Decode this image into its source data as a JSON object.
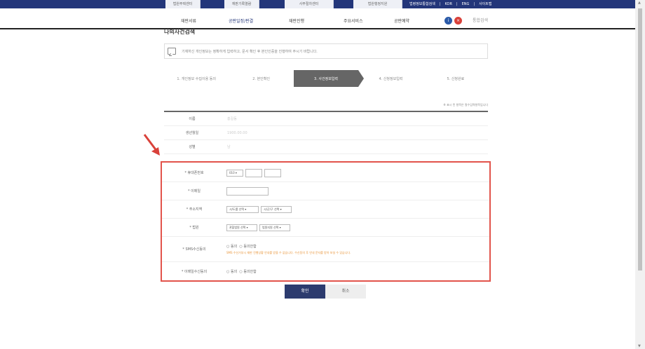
{
  "header": {
    "site_tabs": [
      "법원주택센터",
      "재판기록열람",
      "사무절차센터",
      "법원행정지원"
    ],
    "util_links": [
      "법령정보통합검색",
      "KOR",
      "ENG",
      "사이트맵"
    ],
    "nav": [
      "재판서류",
      "공판일정/판결",
      "재판진행",
      "주요서비스",
      "공판예약",
      "마이페이지"
    ],
    "icons": [
      "info",
      "close"
    ],
    "search": "통합검색"
  },
  "page": {
    "title": "나의사건검색"
  },
  "notice": "기재하신 개인정보는 정확하게 입력하고, 문서 확인 후 본인인증을 진행하여 주시기 바랍니다.",
  "steps": [
    "1. 개인정보 수집이용 동의",
    "2. 본인확인",
    "3. 사건정보입력",
    "4. 신청정보입력",
    "5. 신청완료"
  ],
  "active_step": 2,
  "required_note": "※ 표시 된 항목은 필수입력항목입니다",
  "info_rows": [
    {
      "label": "이름",
      "value": "홍길동"
    },
    {
      "label": "생년월일",
      "value": "1900.00.00"
    },
    {
      "label": "성별",
      "value": "남"
    }
  ],
  "form": {
    "phone_label": "* 휴대폰번호",
    "phone_prefix": "010",
    "email_label": "* 이메일",
    "address_label": "* 주소지역",
    "address_sel1": "시/도를 선택",
    "address_sel2": "시/군/구 선택",
    "court_label": "* 법원",
    "court_sel1": "관할법원 선택",
    "court_sel2": "법원지원 선택",
    "sms_label": "* SMS수신동의",
    "sms_options": [
      "동의",
      "동의안함"
    ],
    "sms_warning": "SMS 수신거부시 재판 진행상황 안내를 받을 수 없습니다. 수신동의 후 안내 문자를 받아 보실 수 있습니다.",
    "email_consent_label": "* 이메일수신동의",
    "email_consent_options": [
      "동의",
      "동의안함"
    ]
  },
  "buttons": {
    "confirm": "확인",
    "cancel": "취소"
  },
  "colors": {
    "navy": "#23367a",
    "highlight": "#e2534b",
    "step_active": "#666666"
  }
}
